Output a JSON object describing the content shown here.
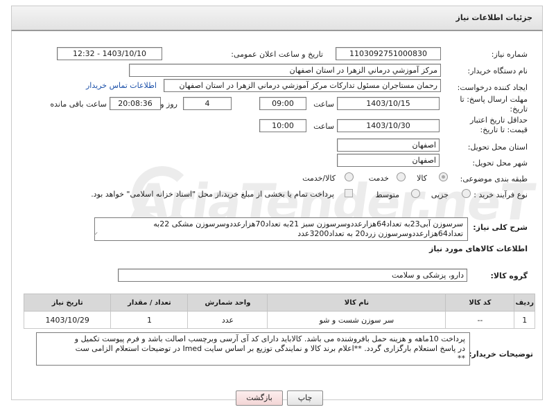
{
  "page_title": "جزئیات اطلاعات نیاز",
  "need_number": {
    "label": "شماره نیاز:",
    "value": "1103092751000830"
  },
  "announce": {
    "label": "تاریخ و ساعت اعلان عمومی:",
    "value": "1403/10/10 - 12:32"
  },
  "buyer_org": {
    "label": "نام دستگاه خریدار:",
    "value": "مرکز آموزشي درماني الزهرا در استان اصفهان"
  },
  "requester": {
    "label": "ایجاد کننده درخواست:",
    "value": "رحمان مستاجران مسئول تدارکات مرکز آموزشي درماني الزهرا در استان اصفهان",
    "contact_link": "اطلاعات تماس خریدار"
  },
  "deadline": {
    "label": "مهلت ارسال پاسخ: تا تاریخ:",
    "date": "1403/10/15",
    "time_label": "ساعت",
    "time": "09:00",
    "days": "4",
    "days_label": "روز و",
    "remaining": "20:08:36",
    "remaining_label": "ساعت باقی مانده"
  },
  "price_validity": {
    "label": "حداقل تاریخ اعتبار قیمت: تا تاریخ:",
    "date": "1403/10/30",
    "time_label": "ساعت",
    "time": "10:00"
  },
  "province": {
    "label": "استان محل تحویل:",
    "value": "اصفهان"
  },
  "city": {
    "label": "شهر محل تحویل:",
    "value": "اصفهان"
  },
  "category": {
    "label": "طبقه بندی موضوعی:",
    "options": [
      "کالا",
      "خدمت",
      "کالا/خدمت"
    ],
    "selected": "کالا"
  },
  "purchase_type": {
    "label": "نوع فرآیند خرید :",
    "options": [
      "جزیی",
      "متوسط"
    ],
    "note": "پرداخت تمام یا بخشی از مبلغ خرید،از محل \"اسناد خزانه اسلامی\" خواهد بود."
  },
  "general_desc": {
    "label": "شرح کلی نیاز:",
    "line1": "سرسوزن آبی23به تعداد64هزارعددوسرسوزن سبز 21به تعداد70هزارعددوسرسوزن مشکی 22به",
    "line2": "تعداد64هزارعددوسرسوزن زرد20 به تعداد3200عدد"
  },
  "goods_section_title": "اطلاعات کالاهای مورد نیاز",
  "goods_group": {
    "label": "گروه کالا:",
    "value": "دارو، پزشکی و سلامت"
  },
  "table": {
    "headers": [
      "ردیف",
      "کد کالا",
      "نام کالا",
      "واحد شمارش",
      "تعداد / مقدار",
      "تاریخ نیاز"
    ],
    "rows": [
      [
        "1",
        "--",
        "سر سوزن شست و شو",
        "عدد",
        "1",
        "1403/10/29"
      ]
    ]
  },
  "buyer_notes": {
    "label": "توضیحات خریدار:",
    "line1": "پرداخت 10ماهه و  هزینه حمل بافروشنده می باشد. کالاباید دارای کد آی آرسی وبرچسب اصالت باشد و فرم پیوست تکمیل و",
    "line2": "در پاسخ استعلام بارگزاری گردد. **اعلام برند کالا و نمایندگی توزیع بر اساس سایت Imed در توضیحات استعلام الزامی ست",
    "line3": "**"
  },
  "buttons": {
    "print": "چاپ",
    "back": "بازگشت"
  },
  "colors": {
    "link": "#1a4fa8",
    "back_button_bg": "#f9e0e0",
    "header_bg": "#d8d8d8"
  }
}
